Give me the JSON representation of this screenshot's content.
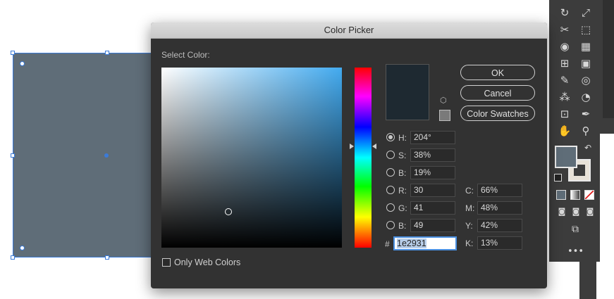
{
  "canvas": {
    "object_color": "#5f6d78",
    "selection_color": "#3b7bd8"
  },
  "tools": {
    "icons": [
      "rotate-icon",
      "scale-icon",
      "warp-icon",
      "free-transform-icon",
      "shape-builder-icon",
      "perspective-grid-icon",
      "mesh-icon",
      "gradient-icon",
      "eyedropper-icon",
      "blend-icon",
      "symbol-sprayer-icon",
      "column-graph-icon",
      "artboard-icon",
      "slice-icon",
      "hand-icon",
      "zoom-icon",
      "swap-fill-stroke-icon",
      "default-colors-icon",
      "color-mode-icon",
      "gradient-mode-icon",
      "none-mode-icon",
      "draw-normal-icon",
      "draw-behind-icon",
      "draw-inside-icon",
      "screen-mode-icon",
      "more-tools-icon"
    ],
    "fill_color": "#5f6d78",
    "stroke_color": "#e8e2d8"
  },
  "dialog": {
    "title": "Color Picker",
    "select_label": "Select Color:",
    "hue_degrees": 204,
    "current_color": "#1e2931",
    "buttons": {
      "ok": "OK",
      "cancel": "Cancel",
      "swatches": "Color Swatches"
    },
    "hsb": [
      {
        "label": "H:",
        "value": "204°",
        "selected": true
      },
      {
        "label": "S:",
        "value": "38%",
        "selected": false
      },
      {
        "label": "B:",
        "value": "19%",
        "selected": false
      }
    ],
    "rgb": [
      {
        "label": "R:",
        "value": "30"
      },
      {
        "label": "G:",
        "value": "41"
      },
      {
        "label": "B:",
        "value": "49"
      }
    ],
    "cmyk": [
      {
        "label": "C:",
        "value": "66%"
      },
      {
        "label": "M:",
        "value": "48%"
      },
      {
        "label": "Y:",
        "value": "42%"
      },
      {
        "label": "K:",
        "value": "13%"
      }
    ],
    "hex_symbol": "#",
    "hex_value": "1e2931",
    "only_web_colors": "Only Web Colors"
  }
}
